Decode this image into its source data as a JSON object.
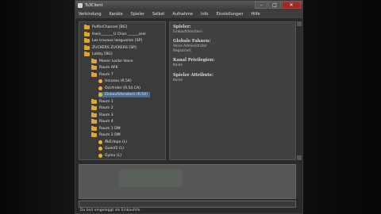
{
  "window": {
    "title": "Ts3Client",
    "controls": [
      "–",
      "□",
      "✕"
    ]
  },
  "menu": [
    "Verbindung",
    "Kanäle",
    "Spieler",
    "Selbst",
    "Aufnahme",
    "Info",
    "Einstellungen",
    "Hilfe"
  ],
  "tree": [
    {
      "label": "PufferChannel [BG]",
      "kind": "folder",
      "indent": 0
    },
    {
      "label": "Here_______U Chan ______arel",
      "kind": "folder",
      "indent": 0
    },
    {
      "label": "Les travaux languaries [SP]",
      "kind": "folder",
      "indent": 0
    },
    {
      "label": "ZUCKERS ZUCKERS [SP]",
      "kind": "folder",
      "indent": 0
    },
    {
      "label": "Lobby [BG]",
      "kind": "folder",
      "indent": 0
    },
    {
      "label": "Mover Locke Voice",
      "kind": "folder",
      "indent": 1
    },
    {
      "label": "Raum AFK",
      "kind": "folder",
      "indent": 1
    },
    {
      "label": "Raum 7",
      "kind": "folder",
      "indent": 1
    },
    {
      "label": "Usrussu (R.54)",
      "kind": "user",
      "indent": 2
    },
    {
      "label": "Ocirfrider (R.54.CA)",
      "kind": "user",
      "indent": 2
    },
    {
      "label": "Einkaufsfenstern (R.54)",
      "kind": "user",
      "indent": 2,
      "selected": true
    },
    {
      "label": "Raum 1",
      "kind": "folder",
      "indent": 1
    },
    {
      "label": "Raum 2",
      "kind": "folder",
      "indent": 1
    },
    {
      "label": "Raum 3",
      "kind": "folder",
      "indent": 1
    },
    {
      "label": "Raum 4",
      "kind": "folder",
      "indent": 1
    },
    {
      "label": "Raum 1 DM",
      "kind": "folder",
      "indent": 1
    },
    {
      "label": "Raum 2 DM",
      "kind": "folder",
      "indent": 1
    },
    {
      "label": "ÄkErlope (L)",
      "kind": "user",
      "indent": 2
    },
    {
      "label": "Guest1 (L)",
      "kind": "user",
      "indent": 2
    },
    {
      "label": "Gyinu (L)",
      "kind": "user",
      "indent": 2
    }
  ],
  "info": {
    "sections": [
      {
        "heading": "Spieler:",
        "value": "Einkaufsfenstern"
      },
      {
        "heading": "Globale Fahnen:",
        "value": "Voice Administrator\nRegistriert"
      },
      {
        "heading": "Kanal Privilegien:",
        "value": "Keine"
      },
      {
        "heading": "Spieler Attribute:",
        "value": "Keine"
      }
    ]
  },
  "status_text": "Du bist eingeloggt als Einkaufsfe"
}
